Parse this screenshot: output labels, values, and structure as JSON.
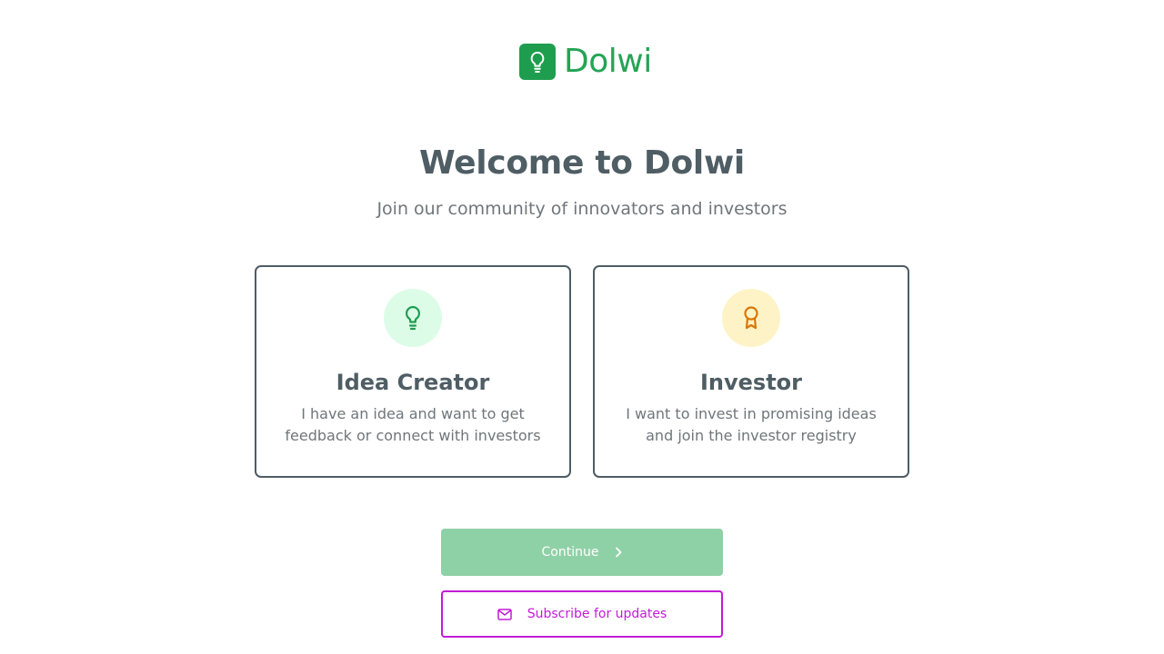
{
  "brand": {
    "name": "Dolwi",
    "logo_icon": "lightbulb-icon",
    "color": "#1f9d4f"
  },
  "header": {
    "title": "Welcome to Dolwi",
    "subtitle": "Join our community of innovators and investors"
  },
  "roles": [
    {
      "title": "Idea Creator",
      "description": "I have an idea and want to get feedback or connect with investors",
      "icon": "lightbulb-icon",
      "icon_color": "#1f9d4f",
      "icon_bg": "#dcfce7"
    },
    {
      "title": "Investor",
      "description": "I want to invest in promising ideas and join the investor registry",
      "icon": "award-icon",
      "icon_color": "#d97706",
      "icon_bg": "#fef3c7"
    }
  ],
  "actions": {
    "continue_label": "Continue",
    "continue_icon": "chevron-right-icon",
    "continue_color": "#8fd1a6",
    "subscribe_label": "Subscribe for updates",
    "subscribe_icon": "mail-icon",
    "subscribe_color": "#c21bd6"
  }
}
